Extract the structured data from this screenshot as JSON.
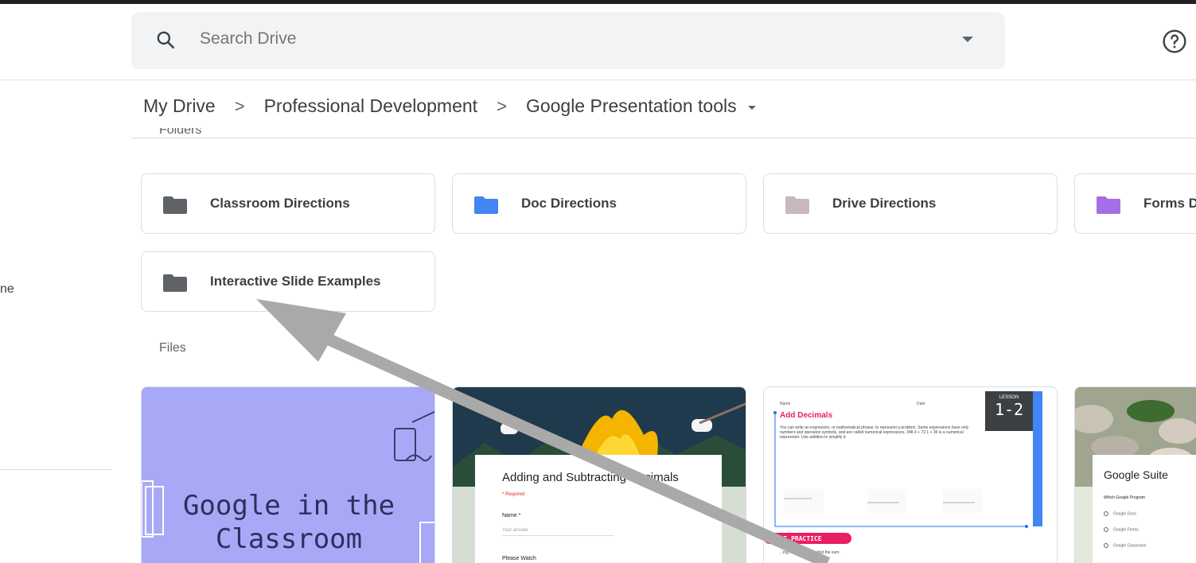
{
  "search": {
    "placeholder": "Search Drive"
  },
  "left_panel": {
    "partial_text": "ne"
  },
  "breadcrumb": {
    "items": [
      "My Drive",
      "Professional Development",
      "Google Presentation tools"
    ],
    "separator": ">"
  },
  "sections": {
    "folders_label": "Folders",
    "files_label": "Files"
  },
  "folders": [
    {
      "name": "Classroom Directions",
      "color": "#5f6368"
    },
    {
      "name": "Doc Directions",
      "color": "#4285f4"
    },
    {
      "name": "Drive Directions",
      "color": "#c9b8bd"
    },
    {
      "name": "Forms Directions",
      "color": "#a56ee6"
    },
    {
      "name": "Interactive Slide Examples",
      "color": "#5f6368"
    }
  ],
  "files": [
    {
      "thumb_title_line1": "Google in the",
      "thumb_title_line2": "Classroom",
      "bg": "#a7a9f7"
    },
    {
      "thumb_title": "Adding and Subtracting Decimals",
      "field1": "Name *",
      "field2": "Your answer",
      "field3": "Please Watch",
      "required": "* Required"
    },
    {
      "heading": "Add Decimals",
      "lesson_label": "LESSON",
      "lesson_number": "1-2",
      "name_label": "Name",
      "date_label": "Date",
      "body": "You can write an expression, or mathematical phrase, to represent a problem. Some expressions have only numbers and operation symbols, and are called numerical expressions. 348.4 + 72.1 + 36 is a numerical expression. Use addition to simplify it.",
      "more_practice": "MORE PRACTICE",
      "bottom_text": "...ing rounding. Then find the sum."
    },
    {
      "thumb_title": "Google Suite",
      "question": "Which Google Program",
      "options": [
        "Google Docs",
        "Google Forms",
        "Google Classroom"
      ]
    }
  ],
  "icons": {
    "search": "search-icon",
    "help": "help-icon",
    "folder": "folder-icon",
    "dropdown": "caret-down-icon"
  },
  "annotation": {
    "arrow_color": "#a9a9a9"
  }
}
